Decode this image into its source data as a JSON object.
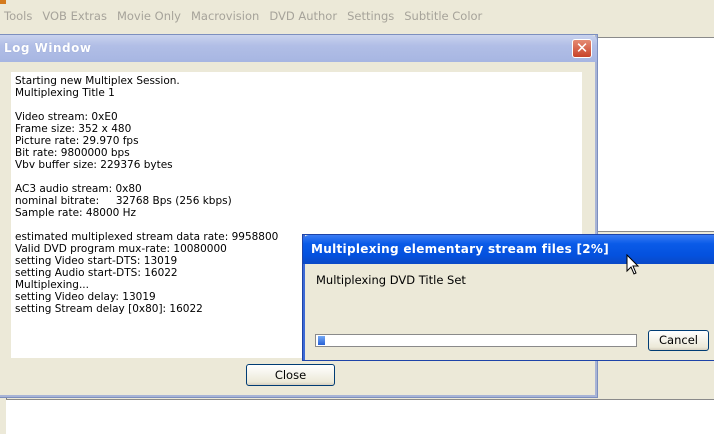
{
  "menubar": {
    "items": [
      "Tools",
      "VOB Extras",
      "Movie Only",
      "Macrovision",
      "DVD Author",
      "Settings",
      "Subtitle Color"
    ]
  },
  "log_window": {
    "title": "Log Window",
    "close_glyph": "✕",
    "lines": [
      "Starting new Multiplex Session.",
      "Multiplexing Title 1",
      "",
      "Video stream: 0xE0",
      "Frame size: 352 x 480",
      "Picture rate: 29.970 fps",
      "Bit rate: 9800000 bps",
      "Vbv buffer size: 229376 bytes",
      "",
      "AC3 audio stream: 0x80",
      "nominal bitrate:     32768 Bps (256 kbps)",
      "Sample rate: 48000 Hz",
      "",
      "estimated multiplexed stream data rate: 9958800",
      "Valid DVD program mux-rate: 10080000",
      "setting Video start-DTS: 13019",
      "setting Audio start-DTS: 16022",
      "Multiplexing...",
      "setting Video delay: 13019",
      "setting Stream delay [0x80]: 16022"
    ],
    "close_button": "Close"
  },
  "progress_dialog": {
    "title": "Multiplexing elementary stream files [2%]",
    "message": "Multiplexing DVD Title Set",
    "progress_percent": 2,
    "cancel_button": "Cancel"
  },
  "colors": {
    "accent": "#0a5be8",
    "inactive_title": "#b1bee6",
    "window_face": "#ece9d8"
  }
}
